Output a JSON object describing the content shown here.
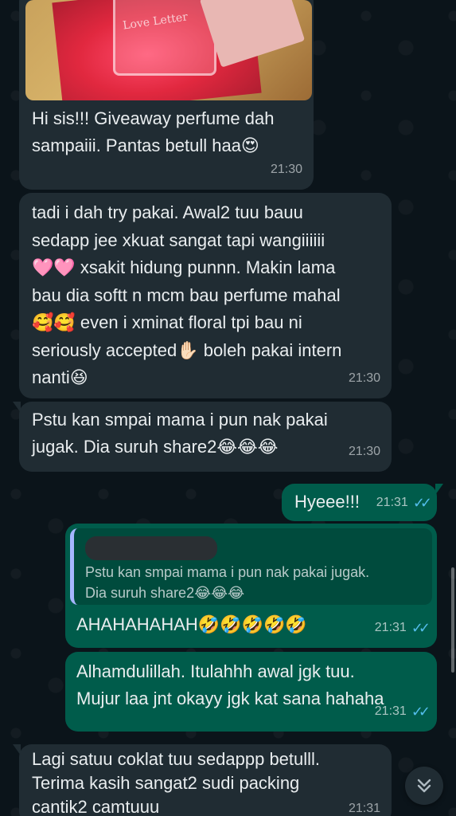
{
  "colors": {
    "background": "#0b141a",
    "incoming_bubble": "#202c33",
    "outgoing_bubble": "#005c4b",
    "read_ticks": "#53bdeb"
  },
  "messages": [
    {
      "direction": "in",
      "has_image": true,
      "image_text": "Love Letter",
      "text": "Hi sis!!! Giveaway perfume dah\nsampaiii. Pantas betull haa😍",
      "time": "21:30"
    },
    {
      "direction": "in",
      "text": "tadi i dah try pakai. Awal2 tuu bauu\nsedapp jee xkuat sangat tapi wangiiiiii\n🩷🩷 xsakit hidung punnn. Makin lama\nbau dia softt n mcm bau perfume mahal\n🥰🥰  even i xminat floral tpi bau ni\nseriously accepted✋🏻 boleh pakai intern\nnanti😆",
      "time": "21:30"
    },
    {
      "direction": "in",
      "text": "Pstu kan smpai mama i pun nak pakai\njugak. Dia suruh share2😂😂😂",
      "time": "21:30"
    },
    {
      "direction": "out",
      "text": "Hyeee!!!",
      "time": "21:31"
    },
    {
      "direction": "out",
      "quoted_text": "Pstu kan smpai mama i pun nak pakai jugak.\nDia suruh share2😂😂😂",
      "text": "AHAHAHAHAH🤣🤣🤣🤣🤣",
      "time": "21:31"
    },
    {
      "direction": "out",
      "text": "Alhamdulillah. Itulahhh awal jgk tuu.\nMujur laa jnt okayy jgk kat sana hahaha",
      "time": "21:31"
    },
    {
      "direction": "in",
      "text": "Lagi satuu coklat tuu sedappp betulll.\nTerima kasih sangat2 sudi packing\ncantik2 camtuuu",
      "time": "21:31"
    }
  ],
  "ticks_symbol": "✓✓",
  "scroll_button_icon": "chevrons-down-icon"
}
